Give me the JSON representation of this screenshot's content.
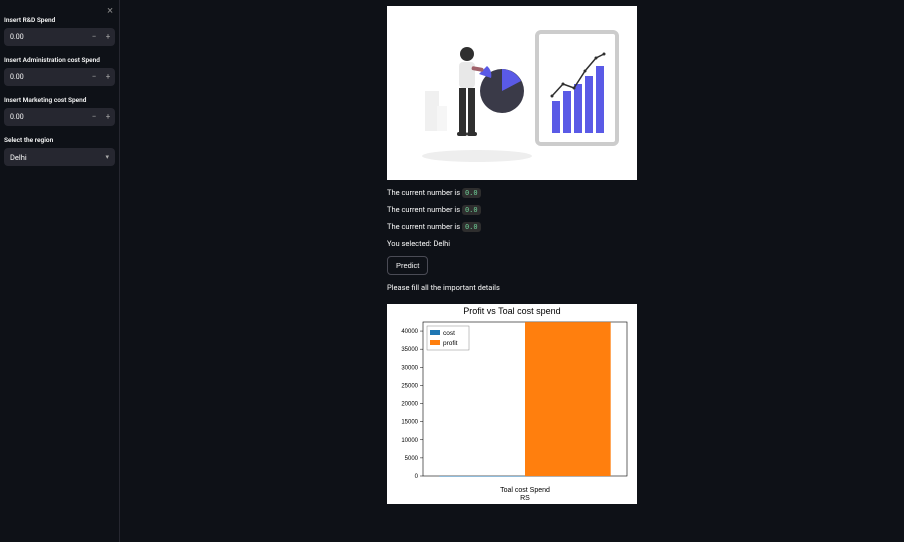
{
  "sidebar": {
    "close_icon": "×",
    "fields": [
      {
        "label": "Insert R&D Spend",
        "value": "0.00",
        "type": "number"
      },
      {
        "label": "Insert Administration cost Spend",
        "value": "0.00",
        "type": "number"
      },
      {
        "label": "Insert Marketing cost Spend",
        "value": "0.00",
        "type": "number"
      },
      {
        "label": "Select the region",
        "value": "Delhi",
        "type": "select"
      }
    ]
  },
  "status": {
    "lines": [
      {
        "prefix": "The current number is ",
        "code": "0.0"
      },
      {
        "prefix": "The current number is ",
        "code": "0.0"
      },
      {
        "prefix": "The current number is ",
        "code": "0.0"
      }
    ],
    "selected": "You selected: Delhi"
  },
  "predict_label": "Predict",
  "warning": "Please fill all the important details",
  "chart_data": {
    "type": "bar",
    "title": "Profit vs Toal cost spend",
    "xlabel": "Toal cost Spend",
    "x_sublabel": "RS",
    "ylabel": "",
    "legend": [
      "cost",
      "profit"
    ],
    "legend_colors": [
      "#1f77b4",
      "#ff7f0e"
    ],
    "categories": [
      ""
    ],
    "series": [
      {
        "name": "cost",
        "values": [
          0
        ]
      },
      {
        "name": "profit",
        "values": [
          42467
        ]
      }
    ],
    "yticks": [
      0,
      5000,
      10000,
      15000,
      20000,
      25000,
      30000,
      35000,
      40000
    ],
    "ylim": [
      0,
      42500
    ]
  }
}
